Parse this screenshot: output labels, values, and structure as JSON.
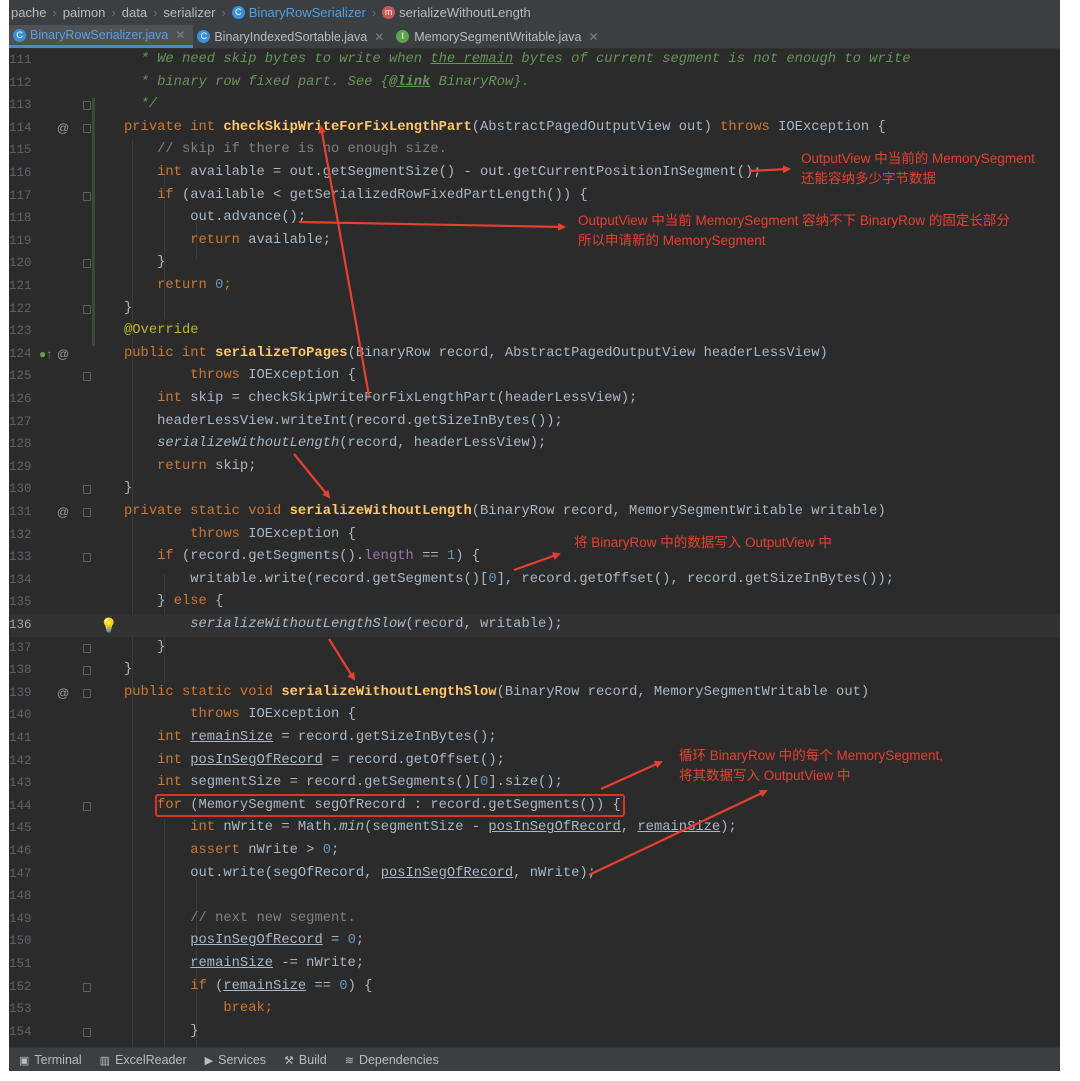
{
  "breadcrumb": [
    "pache",
    "paimon",
    "data",
    "serializer",
    "BinaryRowSerializer",
    "serializeWithoutLength"
  ],
  "tabs": [
    {
      "label": "BinaryRowSerializer.java",
      "active": true,
      "icon": "class-icon"
    },
    {
      "label": "BinaryIndexedSortable.java",
      "active": false,
      "icon": "class-icon"
    },
    {
      "label": "MemorySegmentWritable.java",
      "active": false,
      "icon": "interface-icon"
    }
  ],
  "line_numbers": [
    "111",
    "112",
    "113",
    "114",
    "115",
    "116",
    "117",
    "118",
    "119",
    "120",
    "121",
    "122",
    "123",
    "124",
    "125",
    "126",
    "127",
    "128",
    "129",
    "130",
    "131",
    "132",
    "133",
    "134",
    "135",
    "136",
    "137",
    "138",
    "139",
    "140",
    "141",
    "142",
    "143",
    "144",
    "145",
    "146",
    "147",
    "148",
    "149",
    "150",
    "151",
    "152",
    "153",
    "154"
  ],
  "current_line": "136",
  "code": {
    "l111": {
      "p1": "* We need skip bytes to write when ",
      "p2": "the remain",
      "p3": " bytes of current segment is not enough to write"
    },
    "l112": {
      "p1": "* binary row fixed part. See {",
      "p2": "@link",
      "p3": " BinaryRow}."
    },
    "l113": "*/",
    "l114": {
      "k": "private int ",
      "f": "checkSkipWriteForFixLengthPart",
      "a": "(AbstractPagedOutputView out) ",
      "t": "throws",
      "b": " IOException {"
    },
    "l115": "// skip if there is no enough size.",
    "l116": {
      "k": "int ",
      "r": "available = out.getSegmentSize() - out.getCurrentPositionInSegment();"
    },
    "l117": {
      "k": "if ",
      "r": "(available < getSerializedRowFixedPartLength()) {"
    },
    "l118": "out.advance();",
    "l119": {
      "k": "return ",
      "r": "available;"
    },
    "l120": "}",
    "l121": {
      "k": "return ",
      "n": "0",
      "r": ";"
    },
    "l122": "}",
    "l123": "@Override",
    "l124": {
      "k": "public int ",
      "f": "serializeToPages",
      "r": "(BinaryRow record, AbstractPagedOutputView headerLessView)"
    },
    "l125": {
      "k": "throws ",
      "r": "IOException {"
    },
    "l126": {
      "k": "int ",
      "r": "skip = checkSkipWriteForFixLengthPart(headerLessView);"
    },
    "l127": "headerLessView.writeInt(record.getSizeInBytes());",
    "l128": {
      "i": "serializeWithoutLength",
      "r": "(record, headerLessView);"
    },
    "l129": {
      "k": "return ",
      "r": "skip;"
    },
    "l130": "}",
    "l131": {
      "k": "private static void ",
      "f": "serializeWithoutLength",
      "r": "(BinaryRow record, MemorySegmentWritable writable)"
    },
    "l132": {
      "k": "throws ",
      "r": "IOException {"
    },
    "l133": {
      "k": "if ",
      "a": "(record.getSegments().",
      "fl": "length",
      "b": " == ",
      "n": "1",
      "c": ") {"
    },
    "l134": {
      "a": "writable.write(record.getSegments()[",
      "n": "0",
      "b": "], record.getOffset(), record.getSizeInBytes());"
    },
    "l135": {
      "a": "} ",
      "k": "else",
      "b": " {"
    },
    "l136": {
      "i": "serializeWithoutLengthSlow",
      "r": "(record, writable);"
    },
    "l137": "}",
    "l138": "}",
    "l139": {
      "k": "public static void ",
      "f": "serializeWithoutLengthSlow",
      "r": "(BinaryRow record, MemorySegmentWritable out)"
    },
    "l140": {
      "k": "throws ",
      "r": "IOException {"
    },
    "l141": {
      "k": "int ",
      "u": "remainSize",
      "r": " = record.getSizeInBytes();"
    },
    "l142": {
      "k": "int ",
      "u": "posInSegOfRecord",
      "r": " = record.getOffset();"
    },
    "l143": {
      "k": "int ",
      "a": "segmentSize = record.getSegments()[",
      "n": "0",
      "b": "].size();"
    },
    "l144": {
      "k": "for ",
      "r": "(MemorySegment segOfRecord : record.getSegments()) {"
    },
    "l145": {
      "k": "int ",
      "a": "nWrite = Math.",
      "i": "min",
      "b": "(segmentSize - ",
      "u1": "posInSegOfRecord",
      "c": ", ",
      "u2": "remainSize",
      "d": ");"
    },
    "l146": {
      "k": "assert ",
      "a": "nWrite > ",
      "n": "0",
      "b": ";"
    },
    "l147": {
      "a": "out.write(segOfRecord, ",
      "u": "posInSegOfRecord",
      "b": ", nWrite);"
    },
    "l148": "",
    "l149": "// next new segment.",
    "l150": {
      "u": "posInSegOfRecord",
      "a": " = ",
      "n": "0",
      "b": ";"
    },
    "l151": {
      "u": "remainSize",
      "a": " -= nWrite;"
    },
    "l152": {
      "k": "if ",
      "a": "(",
      "u": "remainSize",
      "b": " == ",
      "n": "0",
      "c": ") {"
    },
    "l153": {
      "k": "break",
      "a": ";"
    },
    "l154": "}"
  },
  "annotations": {
    "a1": [
      "OutputView 中当前的 MemorySegment",
      "还能容纳多少字节数据"
    ],
    "a2": [
      "OutputView 中当前 MemorySegment 容纳不下 BinaryRow 的固定长部分",
      "所以申请新的 MemorySegment"
    ],
    "a3": "将 BinaryRow 中的数据写入 OutputView 中",
    "a4": [
      "循环 BinaryRow 中的每个 MemorySegment,",
      "将其数据写入 OutputView 中"
    ]
  },
  "toolbar": [
    "Terminal",
    "ExcelReader",
    "Services",
    "Build",
    "Dependencies"
  ],
  "colors": {
    "annotation_red": "#e8402f",
    "keyword": "#cc7832",
    "method": "#ffc66d",
    "javadoc": "#629755"
  }
}
